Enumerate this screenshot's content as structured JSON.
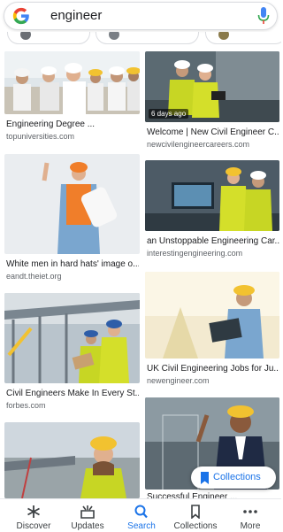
{
  "search": {
    "query": "engineer"
  },
  "results": [
    {
      "title": "Engineering Degree ...",
      "source": "topuniversities.com",
      "badge": ""
    },
    {
      "title": "Welcome | New Civil Engineer C...",
      "source": "newcivilengineercareers.com",
      "badge": "6 days ago"
    },
    {
      "title": "White men in hard hats' image o...",
      "source": "eandt.theiet.org",
      "badge": ""
    },
    {
      "title": "an Unstoppable Engineering Car...",
      "source": "interestingengineering.com",
      "badge": ""
    },
    {
      "title": "Civil Engineers Make In Every St...",
      "source": "forbes.com",
      "badge": ""
    },
    {
      "title": "UK Civil Engineering Jobs for Ju...",
      "source": "newengineer.com",
      "badge": ""
    },
    {
      "title": "",
      "source": "",
      "badge": ""
    },
    {
      "title": "Successful Engineer ...",
      "source": "",
      "badge": ""
    }
  ],
  "collections_button": {
    "label": "Collections"
  },
  "bottom_nav": [
    {
      "label": "Discover",
      "icon": "asterisk-icon"
    },
    {
      "label": "Updates",
      "icon": "updates-icon"
    },
    {
      "label": "Search",
      "icon": "search-icon"
    },
    {
      "label": "Collections",
      "icon": "bookmark-icon"
    },
    {
      "label": "More",
      "icon": "more-dots-icon"
    }
  ],
  "colors": {
    "accent": "#1a73e8",
    "text": "#202124",
    "secondary_text": "#5f6368"
  }
}
